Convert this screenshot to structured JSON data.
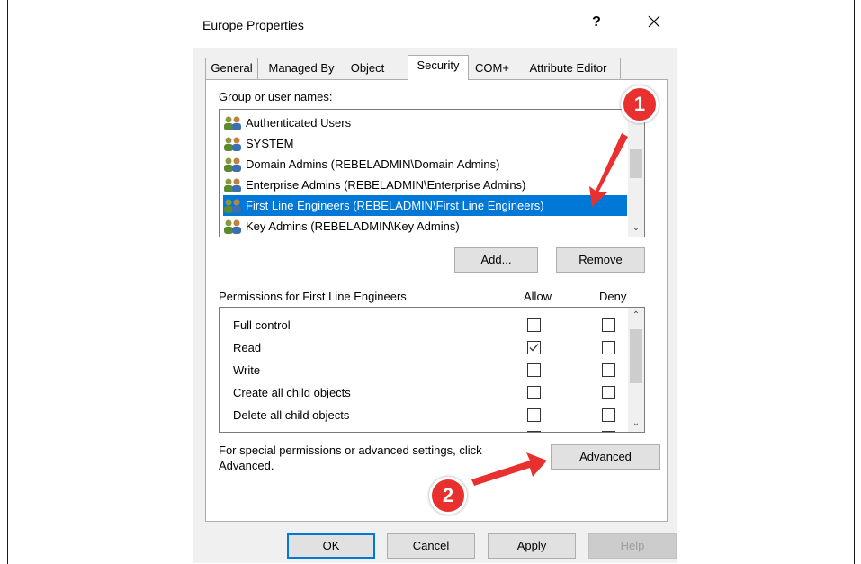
{
  "dialog": {
    "title": "Europe Properties",
    "help_glyph": "?"
  },
  "tabs": [
    {
      "label": "General"
    },
    {
      "label": "Managed By"
    },
    {
      "label": "Object"
    },
    {
      "label": "Security",
      "active": true
    },
    {
      "label": "COM+"
    },
    {
      "label": "Attribute Editor"
    }
  ],
  "security": {
    "group_label": "Group or user names:",
    "users": [
      {
        "name": "Authenticated Users"
      },
      {
        "name": "SYSTEM"
      },
      {
        "name": "Domain Admins (REBELADMIN\\Domain Admins)"
      },
      {
        "name": "Enterprise Admins (REBELADMIN\\Enterprise Admins)"
      },
      {
        "name": "First Line Engineers (REBELADMIN\\First Line Engineers)",
        "selected": true
      },
      {
        "name": "Key Admins (REBELADMIN\\Key Admins)"
      }
    ],
    "add_label": "Add...",
    "remove_label": "Remove",
    "permissions_label": "Permissions for First Line Engineers",
    "allow_header": "Allow",
    "deny_header": "Deny",
    "permissions": [
      {
        "name": "Full control",
        "allow": false,
        "deny": false
      },
      {
        "name": "Read",
        "allow": true,
        "deny": false
      },
      {
        "name": "Write",
        "allow": false,
        "deny": false
      },
      {
        "name": "Create all child objects",
        "allow": false,
        "deny": false
      },
      {
        "name": "Delete all child objects",
        "allow": false,
        "deny": false
      }
    ],
    "advanced_text_line1": "For special permissions or advanced settings, click",
    "advanced_text_line2": "Advanced.",
    "advanced_label": "Advanced"
  },
  "footer": {
    "ok_label": "OK",
    "cancel_label": "Cancel",
    "apply_label": "Apply",
    "help_label": "Help"
  },
  "annotations": {
    "badge_1": "1",
    "badge_2": "2",
    "color": "#e8302f"
  },
  "colors": {
    "selection": "#0078d7",
    "dialog_bg": "#f0f0f0"
  }
}
